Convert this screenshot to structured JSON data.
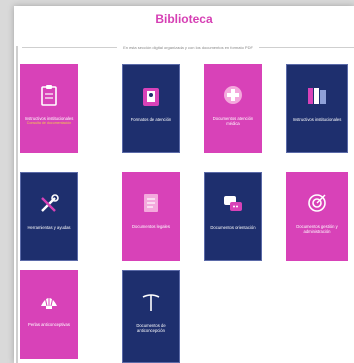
{
  "page": {
    "title": "Biblioteca",
    "subtitle": "En esta sección digital organizada y con los documentos en formato PDF"
  },
  "tiles": [
    {
      "label": "Instructivos institucionales",
      "sub": "Consulta de documentación",
      "color": "magenta",
      "icon": "clipboard-icon"
    },
    {
      "label": "Formatos de atención",
      "color": "navy",
      "icon": "folder-document-icon"
    },
    {
      "label": "Documentos atención médica",
      "color": "magenta",
      "icon": "medical-cross-icon"
    },
    {
      "label": "Instructivos institucionales",
      "color": "navy",
      "icon": "books-icon"
    },
    {
      "label": "Herramientas y ayudas",
      "color": "navy",
      "icon": "tools-icon"
    },
    {
      "label": "Documentos legales",
      "color": "magenta",
      "icon": "legal-document-icon"
    },
    {
      "label": "Documentos orientación",
      "color": "navy",
      "icon": "chat-bubbles-icon"
    },
    {
      "label": "Documentos gestión y administración",
      "color": "magenta",
      "icon": "target-icon"
    },
    {
      "label": "Perlas anticonceptivas",
      "color": "magenta",
      "icon": "shell-icon"
    },
    {
      "label": "Documentos de anticoncepción",
      "color": "navy",
      "icon": "iud-icon"
    }
  ]
}
